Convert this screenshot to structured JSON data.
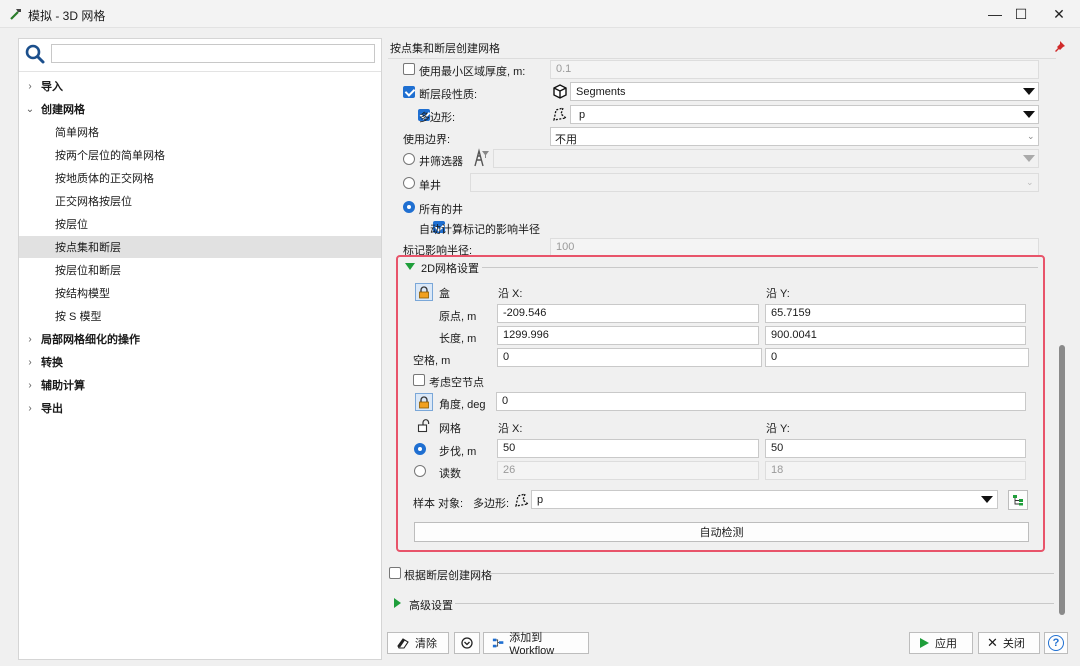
{
  "window": {
    "title": "模拟 - 3D 网格",
    "controls": {
      "minimize": "—",
      "maximize": "☐",
      "close": "✕"
    }
  },
  "sidebar": {
    "search_placeholder": "",
    "items": [
      {
        "label": "导入",
        "type": "category"
      },
      {
        "label": "创建网格",
        "type": "category",
        "expanded": true
      },
      {
        "label": "简单网格",
        "type": "leaf"
      },
      {
        "label": "按两个层位的简单网格",
        "type": "leaf"
      },
      {
        "label": "按地质体的正交网格",
        "type": "leaf"
      },
      {
        "label": "正交网格按层位",
        "type": "leaf"
      },
      {
        "label": "按层位",
        "type": "leaf"
      },
      {
        "label": "按点集和断层",
        "type": "leaf",
        "selected": true
      },
      {
        "label": "按层位和断层",
        "type": "leaf"
      },
      {
        "label": "按结构模型",
        "type": "leaf"
      },
      {
        "label": "按 S 模型",
        "type": "leaf"
      },
      {
        "label": "局部网格细化的操作",
        "type": "category"
      },
      {
        "label": "转换",
        "type": "category"
      },
      {
        "label": "辅助计算",
        "type": "category"
      },
      {
        "label": "导出",
        "type": "category"
      }
    ]
  },
  "panel": {
    "title": "按点集和断层创建网格",
    "min_thickness": {
      "label": "使用最小区域厚度, m:",
      "checked": false,
      "value": "0.1"
    },
    "fault_property": {
      "label": "断层段性质:",
      "checked": true,
      "value": "Segments"
    },
    "polygon": {
      "label": "多边形:",
      "checked": true,
      "value": "p"
    },
    "use_boundary": {
      "label": "使用边界:",
      "value": "不用"
    },
    "well_filter": {
      "label": "井筛选器",
      "selected": false,
      "value": ""
    },
    "single_well": {
      "label": "单井",
      "selected": false,
      "value": ""
    },
    "all_wells": {
      "label": "所有的井",
      "selected": true
    },
    "auto_radius": {
      "label": "自动计算标记的影响半径",
      "checked": true
    },
    "marker_radius": {
      "label": "标记影响半径:",
      "value": "100"
    }
  },
  "grid2d": {
    "section_title": "2D网格设置",
    "box_label": "盒",
    "along_x": "沿 X:",
    "along_y": "沿 Y:",
    "origin": {
      "label": "原点, m",
      "x": "-209.546",
      "y": "65.7159"
    },
    "length": {
      "label": "长度, m",
      "x": "1299.996",
      "y": "900.0041"
    },
    "spacing": {
      "label": "空格, m",
      "x": "0",
      "y": "0"
    },
    "consider_empty": {
      "label": "考虑空节点",
      "checked": false
    },
    "angle": {
      "label": "角度, deg",
      "value": "0"
    },
    "grid_label": "网格",
    "step": {
      "label": "步伐, m",
      "selected": true,
      "x": "50",
      "y": "50"
    },
    "count": {
      "label": "读数",
      "selected": false,
      "x": "26",
      "y": "18"
    },
    "sample_label": "样本 对象:",
    "sample_polygon_label": "多边形:",
    "sample_value": "p",
    "auto_detect": "自动检测"
  },
  "faults_section": {
    "label": "根据断层创建网格",
    "checked": false
  },
  "advanced_section": {
    "label": "高级设置"
  },
  "footer": {
    "clear": "清除",
    "add_workflow": "添加到 Workflow",
    "apply": "应用",
    "close": "关闭",
    "help": "?"
  },
  "colors": {
    "accent": "#1f6fd1",
    "highlight_border": "#e8546a",
    "apply_green": "#1e9e3a"
  }
}
